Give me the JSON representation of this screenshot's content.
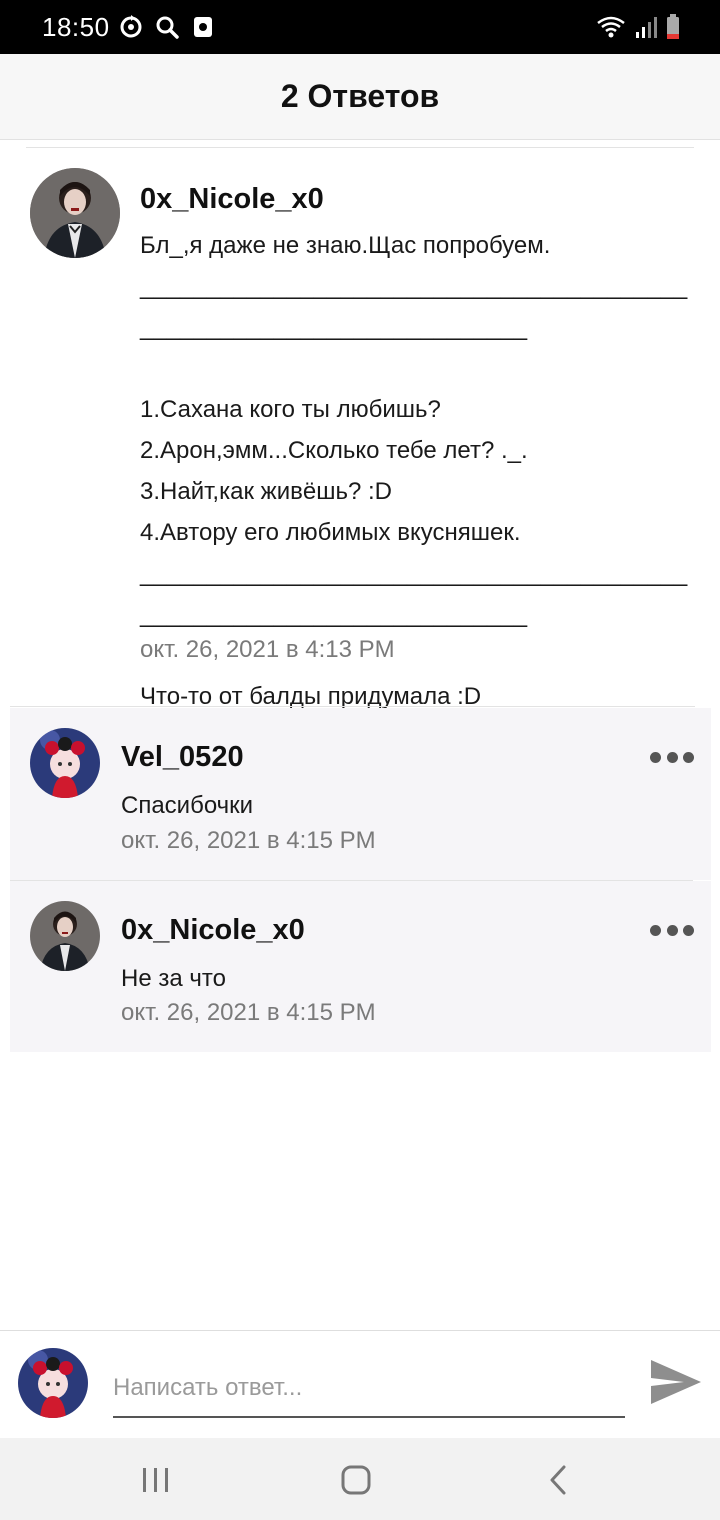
{
  "status_bar": {
    "time": "18:50",
    "left_icons": [
      "sync-icon",
      "search-icon",
      "screenshot-icon"
    ],
    "right_icons": [
      "wifi-icon",
      "signal-icon",
      "battery-icon"
    ]
  },
  "header": {
    "title": "2 Ответов"
  },
  "main_comment": {
    "author": "0x_Nicole_x0",
    "text": "Бл_,я даже не знаю.Щас попробуем.\n_________________________________________\n_____________________________\n\n1.Сахана кого ты любишь?\n2.Арон,эмм...Сколько тебе лет? ._.\n3.Найт,как живёшь? :D\n4.Автору его любимых вкусняшек.\n_________________________________________\n_____________________________\n\nЧто-то от балды придумала :D",
    "date": "окт. 26, 2021 в 4:13 PM"
  },
  "replies": [
    {
      "author": "Vel_0520",
      "text": "Спасибочки",
      "date": "окт. 26, 2021 в 4:15 PM"
    },
    {
      "author": "0x_Nicole_x0",
      "text": "Не за что",
      "date": "окт. 26, 2021 в 4:15 PM"
    }
  ],
  "reply_box": {
    "placeholder": "Написать ответ...",
    "value": ""
  },
  "nav_bar": {
    "buttons": [
      "recent-apps-icon",
      "home-icon",
      "back-icon"
    ]
  },
  "colors": {
    "accent_dark": "#111111",
    "date_gray": "#7a7a7a",
    "reply_bg": "#f6f5f8"
  }
}
